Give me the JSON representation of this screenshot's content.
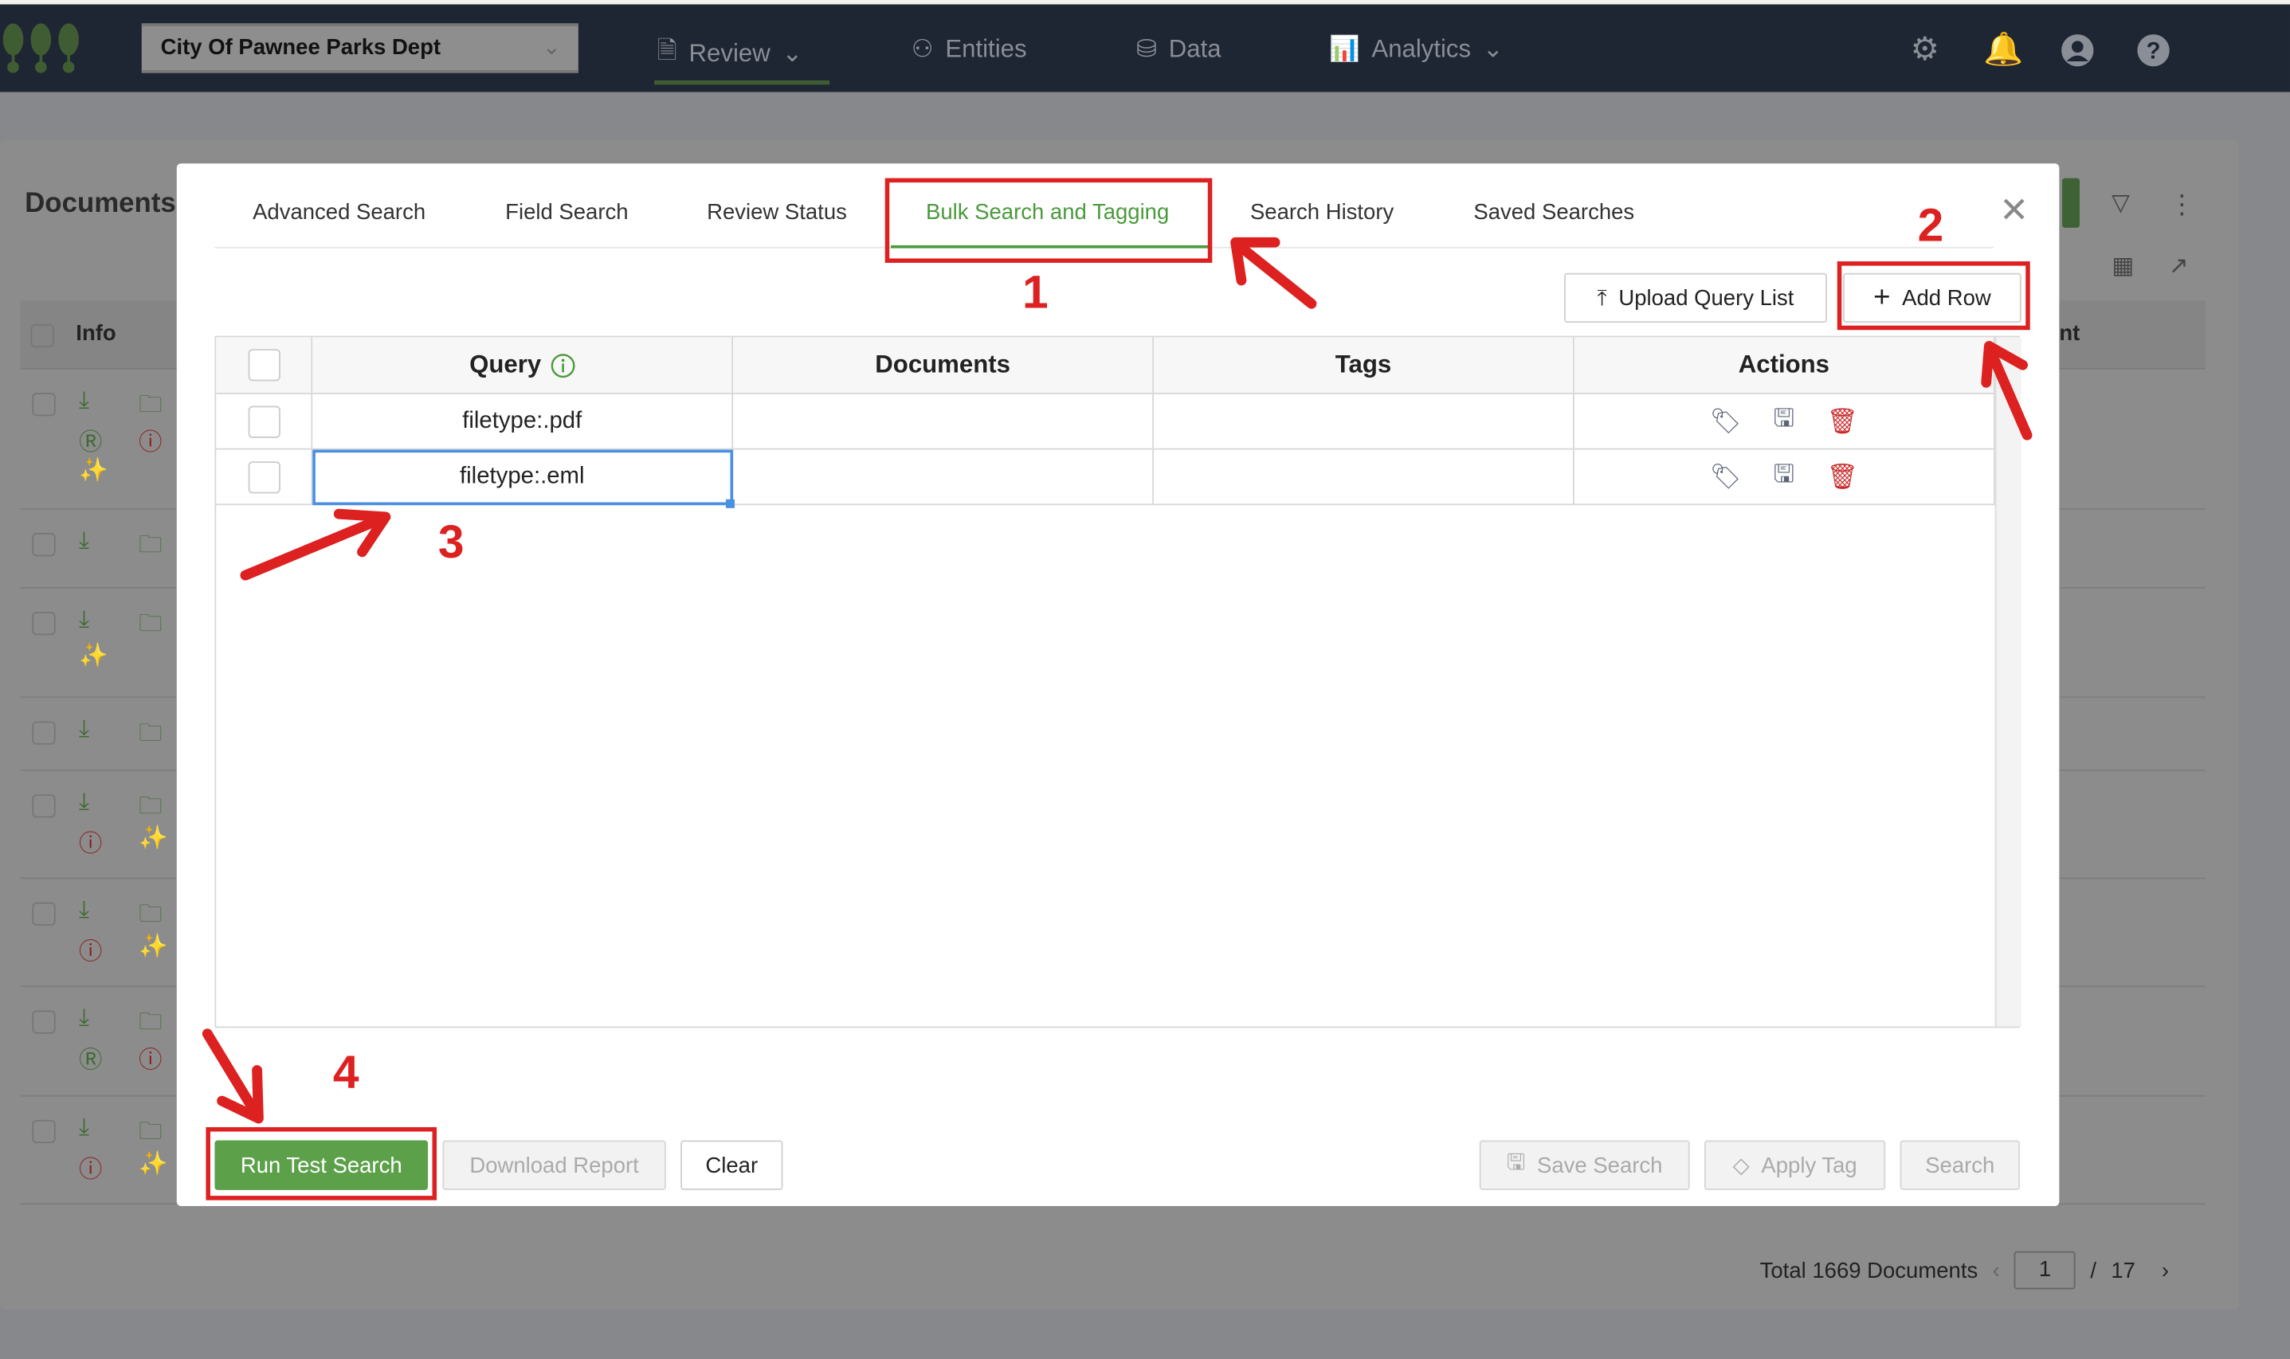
{
  "navbar": {
    "org_selector": "City Of Pawnee Parks Dept",
    "items": [
      {
        "label": "Review",
        "icon": "document-icon",
        "dropdown": true,
        "active": true
      },
      {
        "label": "Entities",
        "icon": "entities-icon",
        "dropdown": false
      },
      {
        "label": "Data",
        "icon": "database-icon",
        "dropdown": false
      },
      {
        "label": "Analytics",
        "icon": "bar-chart-icon",
        "dropdown": true
      }
    ],
    "right_icons": [
      "gear-icon",
      "bell-icon",
      "user-icon",
      "help-icon"
    ]
  },
  "background": {
    "title": "Documents",
    "info_header": "Info",
    "partial_header": "nt",
    "pagination": {
      "total_label": "Total 1669 Documents",
      "page": "1",
      "separator": "/",
      "pages": "17"
    }
  },
  "modal": {
    "tabs": [
      "Advanced Search",
      "Field Search",
      "Review Status",
      "Bulk Search and Tagging",
      "Search History",
      "Saved Searches"
    ],
    "active_tab": "Bulk Search and Tagging",
    "upload_label": "Upload Query List",
    "add_row_label": "Add Row",
    "columns": [
      "Query",
      "Documents",
      "Tags",
      "Actions"
    ],
    "rows": [
      {
        "query": "filetype:.pdf",
        "documents": "",
        "tags": ""
      },
      {
        "query": "filetype:.eml",
        "documents": "",
        "tags": ""
      }
    ],
    "buttons": {
      "run_test": "Run Test Search",
      "download": "Download Report",
      "clear": "Clear",
      "save_search": "Save Search",
      "apply_tag": "Apply Tag",
      "search": "Search"
    }
  },
  "annotations": [
    "1",
    "2",
    "3",
    "4"
  ],
  "colors": {
    "accent": "#4a9a3c",
    "annotation": "#dd2020",
    "navbar": "#1e2533",
    "run_button": "#5ca04a"
  }
}
